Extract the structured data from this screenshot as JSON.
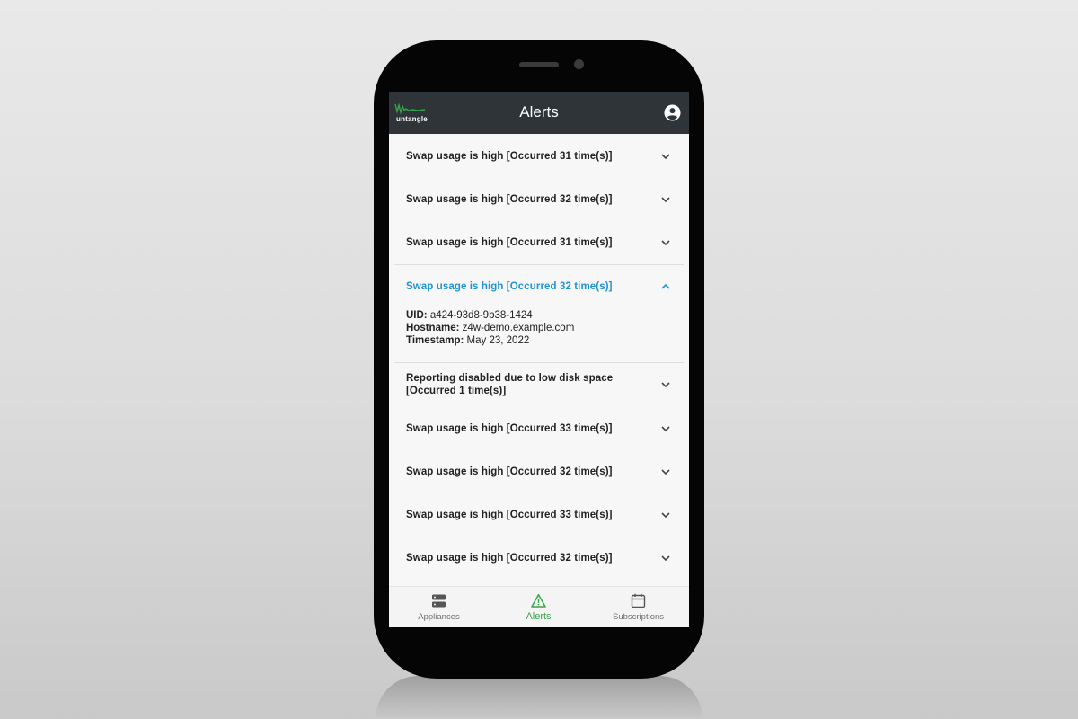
{
  "app": {
    "title": "Alerts",
    "logo_text": "untangle",
    "accent_color": "#1f93d6",
    "brand_color": "#38a44a",
    "header_color": "#2f3438"
  },
  "alerts": [
    {
      "title": "Swap usage is high [Occurred 31 time(s)]",
      "expanded": false
    },
    {
      "title": "Swap usage is high [Occurred 32 time(s)]",
      "expanded": false
    },
    {
      "title": "Swap usage is high [Occurred 31 time(s)]",
      "expanded": false
    },
    {
      "title": "Swap usage is high [Occurred 32 time(s)]",
      "expanded": true,
      "details": {
        "uid_label": "UID:",
        "uid": "a424-93d8-9b38-1424",
        "hostname_label": "Hostname:",
        "hostname": "z4w-demo.example.com",
        "timestamp_label": "Timestamp:",
        "timestamp": "May 23, 2022"
      }
    },
    {
      "title": "Reporting disabled due to low disk space [Occurred 1 time(s)]",
      "expanded": false
    },
    {
      "title": "Swap usage is high [Occurred 33 time(s)]",
      "expanded": false
    },
    {
      "title": "Swap usage is high [Occurred 32 time(s)]",
      "expanded": false
    },
    {
      "title": "Swap usage is high [Occurred 33 time(s)]",
      "expanded": false
    },
    {
      "title": "Swap usage is high [Occurred 32 time(s)]",
      "expanded": false
    }
  ],
  "bottom_nav": [
    {
      "label": "Appliances",
      "icon": "server-icon",
      "active": false
    },
    {
      "label": "Alerts",
      "icon": "warning-icon",
      "active": true
    },
    {
      "label": "Subscriptions",
      "icon": "calendar-icon",
      "active": false
    }
  ]
}
